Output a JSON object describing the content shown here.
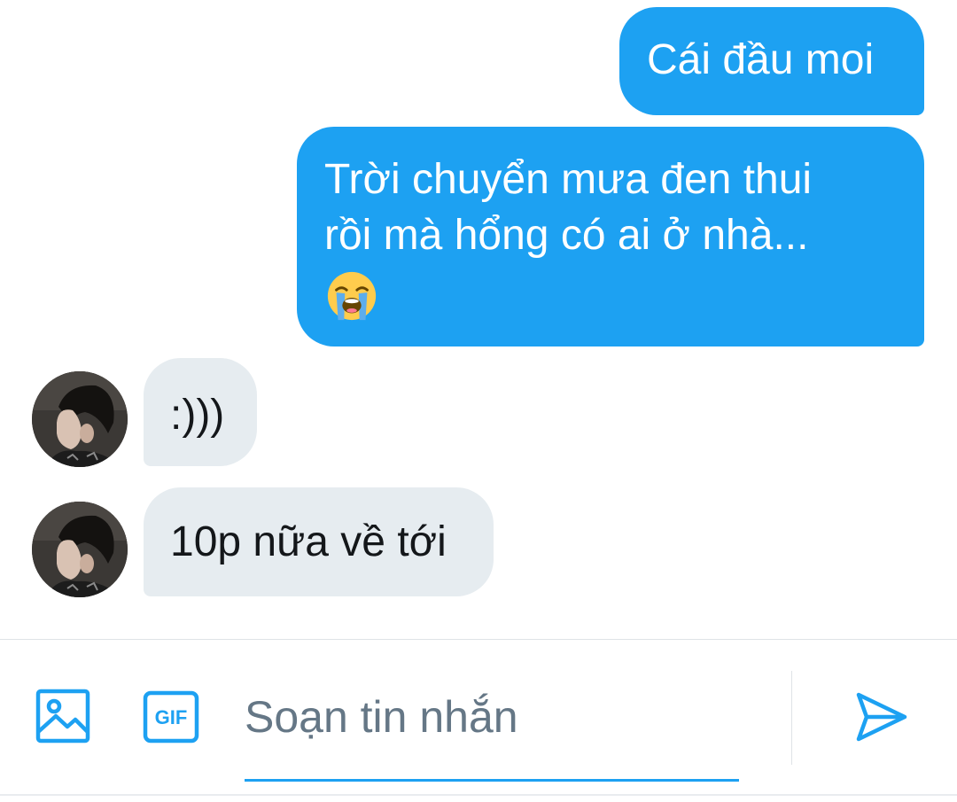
{
  "messages": {
    "sent": [
      {
        "text": "Cái đầu moi"
      },
      {
        "lines": [
          "Trời chuyển mưa đen thui",
          "rồi mà hổng có ai ở nhà..."
        ],
        "emoji": "loudly-crying-face"
      }
    ],
    "received": [
      {
        "text": ":)))"
      },
      {
        "text": "10p nữa về tới"
      }
    ]
  },
  "composer": {
    "placeholder": "Soạn tin nhắn",
    "gif_label": "GIF"
  },
  "colors": {
    "accent": "#1da1f2",
    "received_bubble": "#e6ecf0",
    "placeholder": "#657786"
  },
  "icons": [
    "image-icon",
    "gif-icon",
    "send-icon",
    "loudly-crying-face-emoji"
  ]
}
